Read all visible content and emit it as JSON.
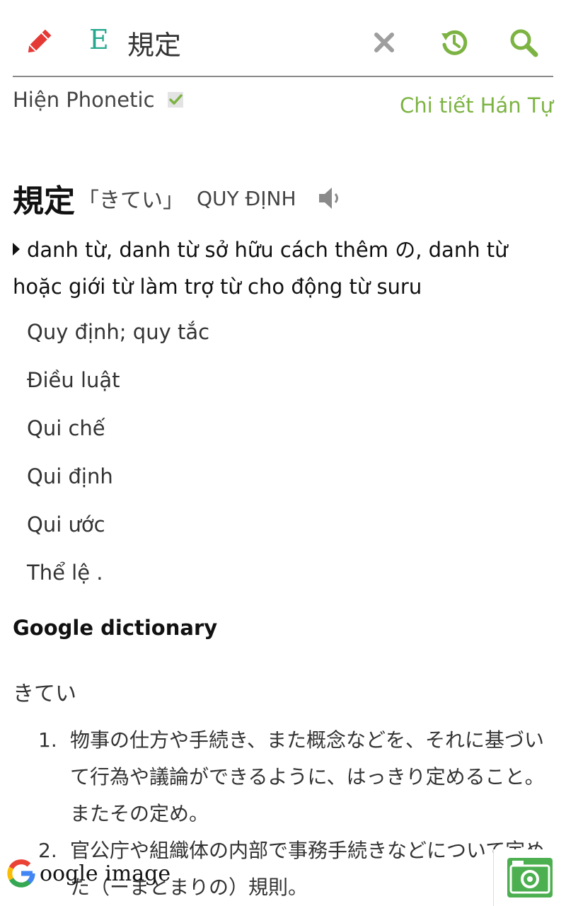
{
  "header": {
    "mode_letter": "E",
    "search_value": "規定"
  },
  "options": {
    "phonetic_label": "Hiện Phonetic",
    "phonetic_checked": true,
    "kanji_detail_link": "Chi tiết Hán Tự"
  },
  "entry": {
    "word": "規定",
    "reading": "「きてい」",
    "han_viet": "QUY ĐỊNH",
    "part_of_speech": "danh từ, danh từ sở hữu cách thêm の, danh từ hoặc giới từ làm trợ từ cho động từ suru",
    "meanings": [
      "Quy định; quy tắc",
      "Điều luật",
      "Qui chế",
      "Qui định",
      "Qui ước",
      "Thể lệ ."
    ]
  },
  "google_dictionary": {
    "title": "Google dictionary",
    "reading": "きてい",
    "definitions": [
      {
        "num": "1.",
        "text": "物事の仕方や手続き、また概念などを、それに基づいて行為や議論ができるように、はっきり定めること。またその定め。"
      },
      {
        "num": "2.",
        "text": "官公庁や組織体の内部で事務手続きなどについて定めた（ーまとまりの）規則。"
      }
    ]
  },
  "footer": {
    "google_image_label": "oogle image"
  },
  "colors": {
    "accent_green": "#7cb342",
    "teal": "#26a88f",
    "pencil_red": "#e53935",
    "icon_gray": "#9e9e9e"
  }
}
